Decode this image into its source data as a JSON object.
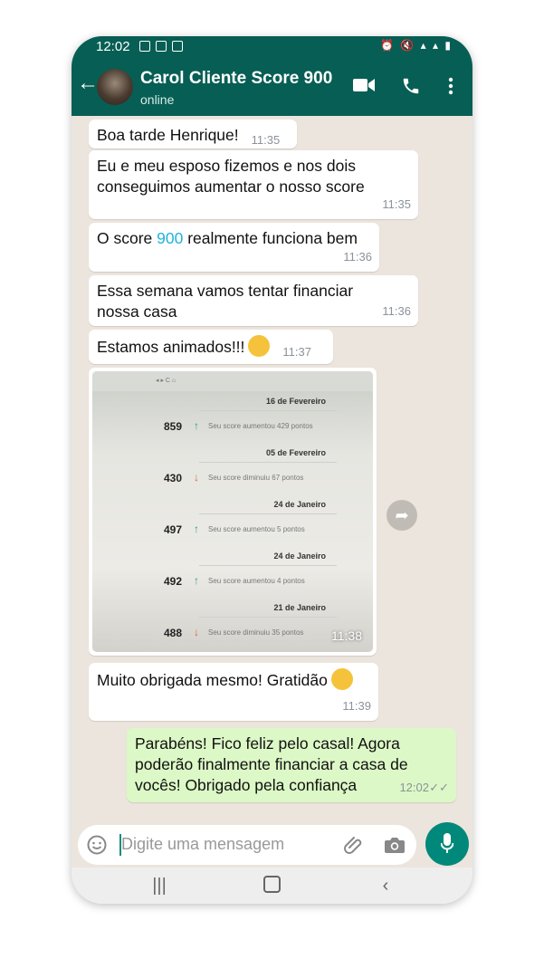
{
  "status_bar": {
    "time": "12:02"
  },
  "header": {
    "contact_name": "Carol Cliente Score 900",
    "status": "online"
  },
  "messages": [
    {
      "text": "Boa tarde Henrique!",
      "time": "11:35",
      "direction": "in"
    },
    {
      "text": "Eu e meu esposo fizemos e nos dois\nconseguimos aumentar o nosso score",
      "time": "11:35",
      "direction": "in"
    },
    {
      "text_before": "O score ",
      "highlight": "900",
      "text_after": " realmente funciona bem",
      "time": "11:36",
      "direction": "in"
    },
    {
      "text": "Essa semana vamos tentar financiar\nnossa casa",
      "time": "11:36",
      "direction": "in"
    },
    {
      "text": "Estamos animados!!!",
      "time": "11:37",
      "direction": "in",
      "emoji": "star-struck-emoji"
    },
    {
      "type": "image",
      "time": "11:38",
      "direction": "in"
    },
    {
      "text": "Muito obrigada mesmo! Gratidão",
      "time": "11:39",
      "direction": "in",
      "emoji": "kissing-emoji"
    },
    {
      "text": "Parabéns! Fico feliz pelo casal! Agora\npoderão finalmente financiar a casa de\nvocês! Obrigado pela confiança",
      "time": "12:02",
      "direction": "out",
      "status": "read"
    }
  ],
  "image_content": {
    "entries": [
      {
        "date": "16 de Fevereiro",
        "score": "859",
        "trend": "up",
        "desc": "Seu score aumentou 429 pontos"
      },
      {
        "date": "05 de Fevereiro",
        "score": "430",
        "trend": "down",
        "desc": "Seu score diminuiu 67 pontos"
      },
      {
        "date": "24 de Janeiro",
        "score": "497",
        "trend": "up",
        "desc": "Seu score aumentou 5 pontos"
      },
      {
        "date": "24 de Janeiro",
        "score": "492",
        "trend": "up",
        "desc": "Seu score aumentou 4 pontos"
      },
      {
        "date": "21 de Janeiro",
        "score": "488",
        "trend": "down",
        "desc": "Seu score diminuiu 35 pontos"
      }
    ]
  },
  "input": {
    "placeholder": "Digite uma mensagem"
  },
  "colors": {
    "header": "#075e54",
    "outgoing_bubble": "#dcf8c6",
    "incoming_bubble": "#ffffff",
    "mic_button": "#00897b",
    "highlight": "#1eb4d6"
  }
}
